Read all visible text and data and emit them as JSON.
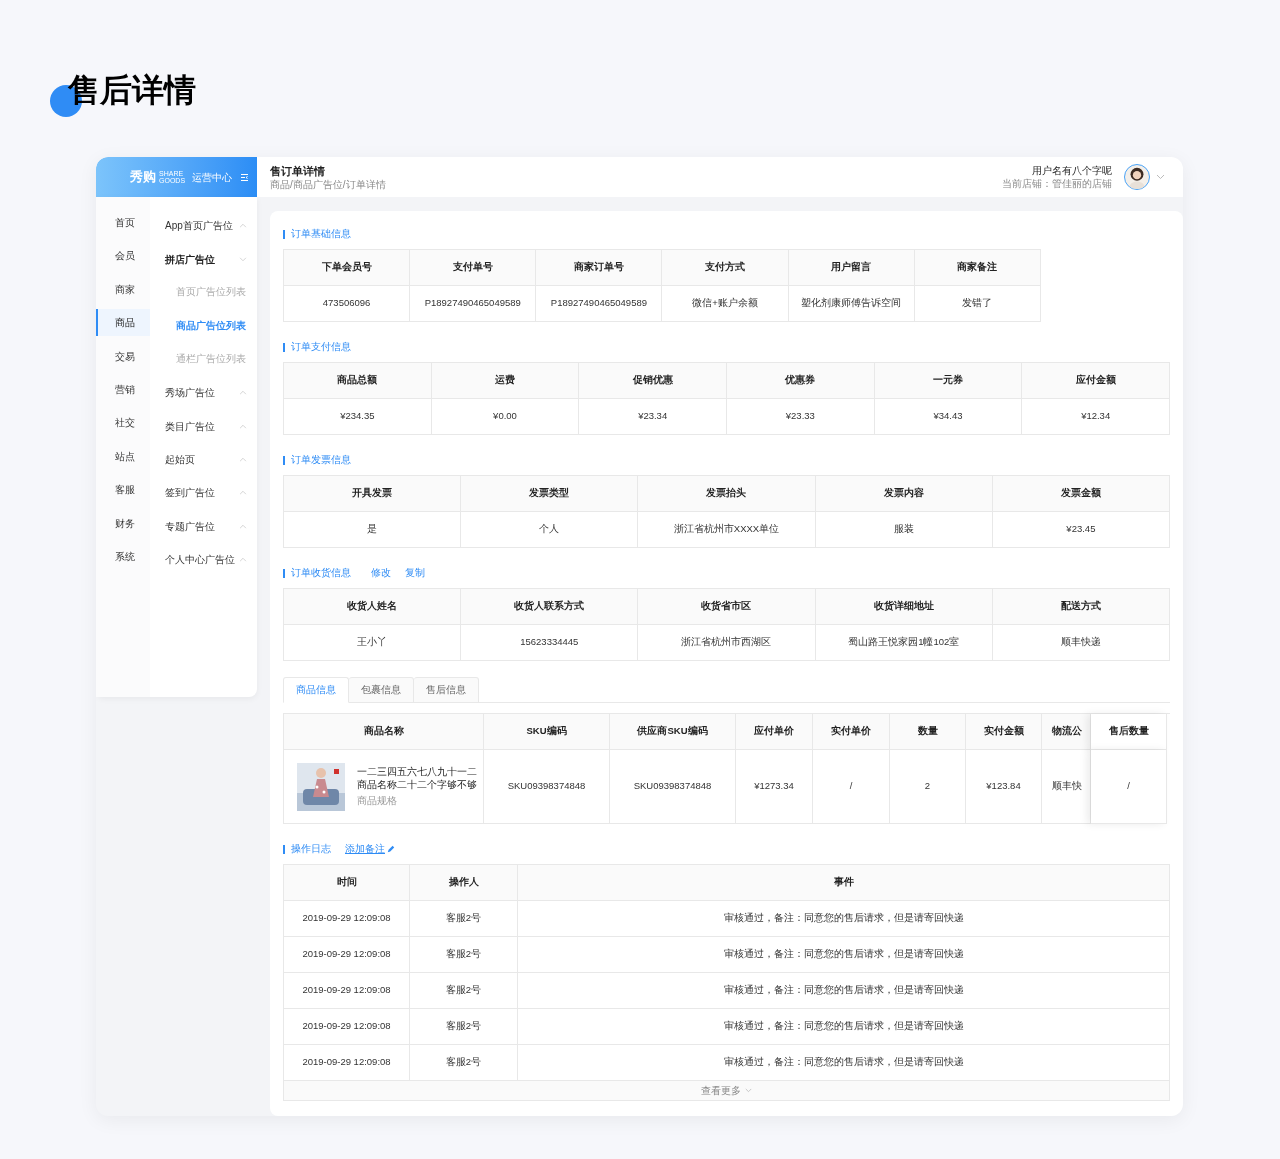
{
  "page_title": "售后详情",
  "sidebar": {
    "logo": {
      "brand": "秀购",
      "brand_en_top": "SHARE",
      "brand_en_bottom": "GOODS",
      "subtitle": "运营中心"
    },
    "primary_items": [
      {
        "label": "首页",
        "selected": false
      },
      {
        "label": "会员",
        "selected": false
      },
      {
        "label": "商家",
        "selected": false
      },
      {
        "label": "商品",
        "selected": true
      },
      {
        "label": "交易",
        "selected": false
      },
      {
        "label": "营销",
        "selected": false
      },
      {
        "label": "社交",
        "selected": false
      },
      {
        "label": "站点",
        "selected": false
      },
      {
        "label": "客服",
        "selected": false
      },
      {
        "label": "财务",
        "selected": false
      },
      {
        "label": "系统",
        "selected": false
      }
    ],
    "secondary_items": [
      {
        "label": "App首页广告位",
        "expanded": false
      },
      {
        "label": "拼店广告位",
        "expanded": true,
        "children": [
          {
            "label": "首页广告位列表",
            "selected": false
          },
          {
            "label": "商品广告位列表",
            "selected": true
          },
          {
            "label": "通栏广告位列表",
            "selected": false
          }
        ]
      },
      {
        "label": "秀场广告位",
        "expanded": false
      },
      {
        "label": "类目广告位",
        "expanded": false
      },
      {
        "label": "起始页",
        "expanded": false
      },
      {
        "label": "签到广告位",
        "expanded": false
      },
      {
        "label": "专题广告位",
        "expanded": false
      },
      {
        "label": "个人中心广告位",
        "expanded": false
      }
    ]
  },
  "header": {
    "title": "售订单详情",
    "breadcrumb": "商品/商品广告位/订单详情",
    "user": {
      "name": "用户名有八个字呢",
      "store": "当前店铺：管佳丽的店铺"
    }
  },
  "sections": [
    {
      "kind": "table",
      "title": "订单基础信息",
      "columns": [
        "下单会员号",
        "支付单号",
        "商家订单号",
        "支付方式",
        "用户留言",
        "商家备注"
      ],
      "rows": [
        [
          "473506096",
          "P18927490465049589",
          "P18927490465049589",
          "微信+账户余额",
          "塑化剂康师傅告诉空间",
          "发错了"
        ]
      ]
    },
    {
      "kind": "table",
      "title": "订单支付信息",
      "columns": [
        "商品总额",
        "运费",
        "促销优惠",
        "优惠券",
        "一元券",
        "应付金额"
      ],
      "rows": [
        [
          "¥234.35",
          "¥0.00",
          "¥23.34",
          "¥23.33",
          "¥34.43",
          "¥12.34"
        ]
      ]
    },
    {
      "kind": "table",
      "title": "订单发票信息",
      "columns": [
        "开具发票",
        "发票类型",
        "发票抬头",
        "发票内容",
        "发票金额"
      ],
      "rows": [
        [
          "是",
          "个人",
          "浙江省杭州市XXXX单位",
          "服装",
          "¥23.45"
        ]
      ]
    },
    {
      "kind": "table",
      "title": "订单收货信息",
      "actions": [
        "修改",
        "复制"
      ],
      "columns": [
        "收货人姓名",
        "收货人联系方式",
        "收货省市区",
        "收货详细地址",
        "配送方式"
      ],
      "rows": [
        [
          "王小丫",
          "15623334445",
          "浙江省杭州市西湖区",
          "蜀山路王悦家园1幢102室",
          "顺丰快递"
        ]
      ]
    },
    {
      "kind": "product",
      "tabs": [
        {
          "label": "商品信息",
          "selected": true
        },
        {
          "label": "包裹信息",
          "selected": false
        },
        {
          "label": "售后信息",
          "selected": false
        }
      ],
      "columns": [
        "商品名称",
        "SKU编码",
        "供应商SKU编码",
        "应付单价",
        "实付单价",
        "数量",
        "实付金额",
        "物流公",
        "售后数量"
      ],
      "rows": [
        {
          "cells": [
            {
              "name": "一二三四五六七八九十一二商品名称二十二个字够不够",
              "spec": "商品规格"
            },
            "SKU09398374848",
            "SKU09398374848",
            "¥1273.34",
            "/",
            "2",
            "¥123.84",
            "顺丰快",
            "/"
          ]
        }
      ]
    },
    {
      "kind": "log",
      "title": "操作日志",
      "link": "添加备注",
      "columns": [
        "时间",
        "操作人",
        "事件"
      ],
      "rows": [
        [
          "2019-09-29 12:09:08",
          "客服2号",
          "审核通过，备注：同意您的售后请求，但是请寄回快递"
        ],
        [
          "2019-09-29 12:09:08",
          "客服2号",
          "审核通过，备注：同意您的售后请求，但是请寄回快递"
        ],
        [
          "2019-09-29 12:09:08",
          "客服2号",
          "审核通过，备注：同意您的售后请求，但是请寄回快递"
        ],
        [
          "2019-09-29 12:09:08",
          "客服2号",
          "审核通过，备注：同意您的售后请求，但是请寄回快递"
        ],
        [
          "2019-09-29 12:09:08",
          "客服2号",
          "审核通过，备注：同意您的售后请求，但是请寄回快递"
        ]
      ],
      "more": "查看更多"
    }
  ]
}
